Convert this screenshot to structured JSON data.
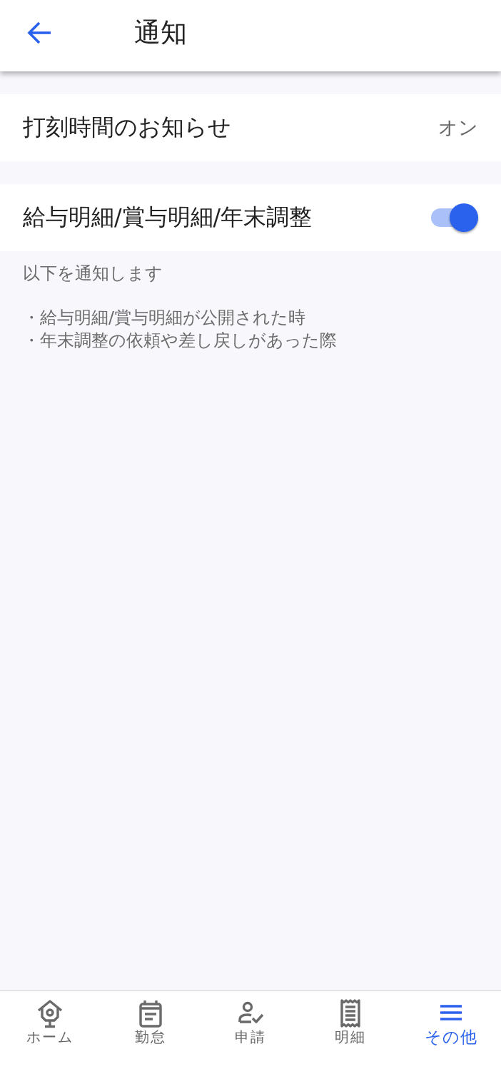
{
  "header": {
    "title": "通知"
  },
  "settings": [
    {
      "kind": "value",
      "label": "打刻時間のお知らせ",
      "value": "オン"
    },
    {
      "kind": "switch",
      "label": "給与明細/賞与明細/年末調整",
      "on": true
    }
  ],
  "description": {
    "intro": "以下を通知します",
    "items": [
      "・給与明細/賞与明細が公開された時",
      "・年末調整の依頼や差し戻しがあった際"
    ]
  },
  "bottom_nav": [
    {
      "label": "ホーム",
      "selected": false
    },
    {
      "label": "勤怠",
      "selected": false
    },
    {
      "label": "申請",
      "selected": false
    },
    {
      "label": "明細",
      "selected": false
    },
    {
      "label": "その他",
      "selected": true
    }
  ]
}
